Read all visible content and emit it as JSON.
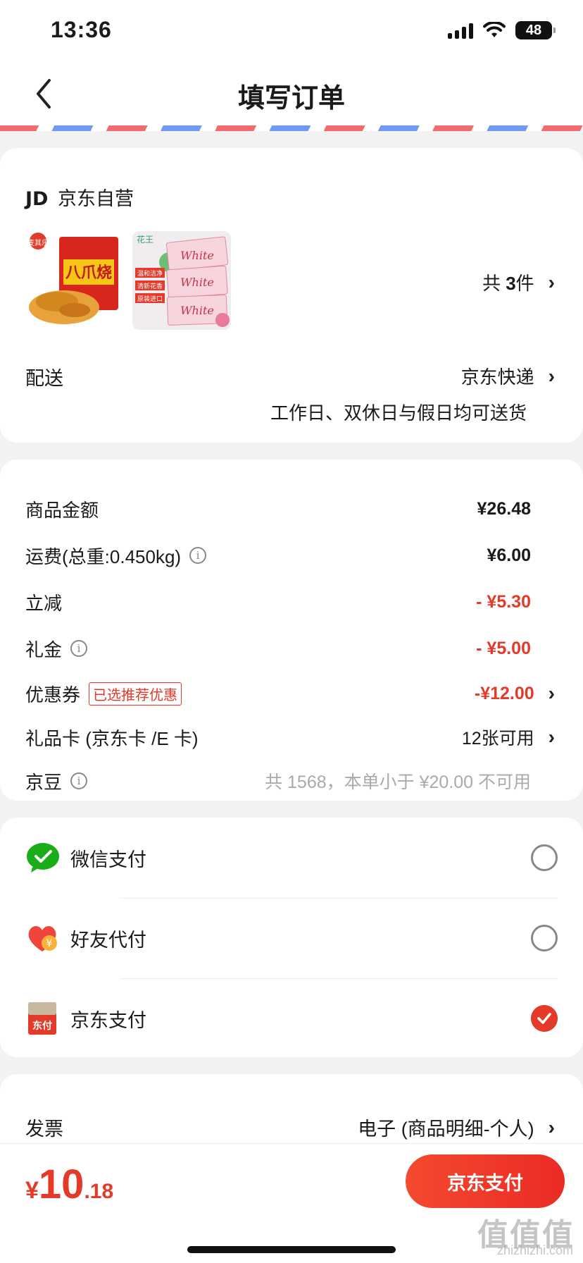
{
  "status_bar": {
    "time": "13:36",
    "battery": "48"
  },
  "nav": {
    "title": "填写订单"
  },
  "shop": {
    "logo": "JD",
    "name": "京东自营",
    "quantity_prefix": "共",
    "quantity": "3",
    "quantity_suffix": "件",
    "product1_brand": "麦其乐",
    "product1_name": "八爪烧",
    "product2_brand": "花王",
    "product2_badges": [
      "温和洁净",
      "清新花香",
      "原装进口"
    ],
    "product2_label": "White",
    "delivery_label": "配送",
    "delivery_method": "京东快递",
    "delivery_note": "工作日、双休日与假日均可送货"
  },
  "price": {
    "rows": [
      {
        "label": "商品金额",
        "value": "¥26.48"
      },
      {
        "label": "运费(总重:0.450kg)",
        "value": "¥6.00"
      },
      {
        "label": "立减",
        "value": "- ¥5.30"
      },
      {
        "label": "礼金",
        "value": "- ¥5.00"
      },
      {
        "label": "优惠券",
        "tag": "已选推荐优惠",
        "value": "-¥12.00"
      },
      {
        "label": "礼品卡 (京东卡 /E 卡)",
        "value": "12张可用"
      },
      {
        "label": "京豆",
        "value": "共 1568，本单小于 ¥20.00 不可用"
      }
    ]
  },
  "payment": {
    "options": [
      {
        "label": "微信支付",
        "selected": false
      },
      {
        "label": "好友代付",
        "selected": false
      },
      {
        "label": "京东支付",
        "selected": true
      }
    ],
    "icon_text": {
      "jd": "东付",
      "friend": "¥"
    }
  },
  "invoice": {
    "label": "发票",
    "value": "电子 (商品明细-个人)"
  },
  "footer": {
    "currency": "¥",
    "total_int": "10",
    "total_dec": ".18",
    "pay_button": "京东支付"
  },
  "watermark": {
    "main": "值值值",
    "sub": "zhizhizhi.com"
  },
  "colors": {
    "accent": "#e33a2a",
    "wechat": "#1aad19"
  }
}
